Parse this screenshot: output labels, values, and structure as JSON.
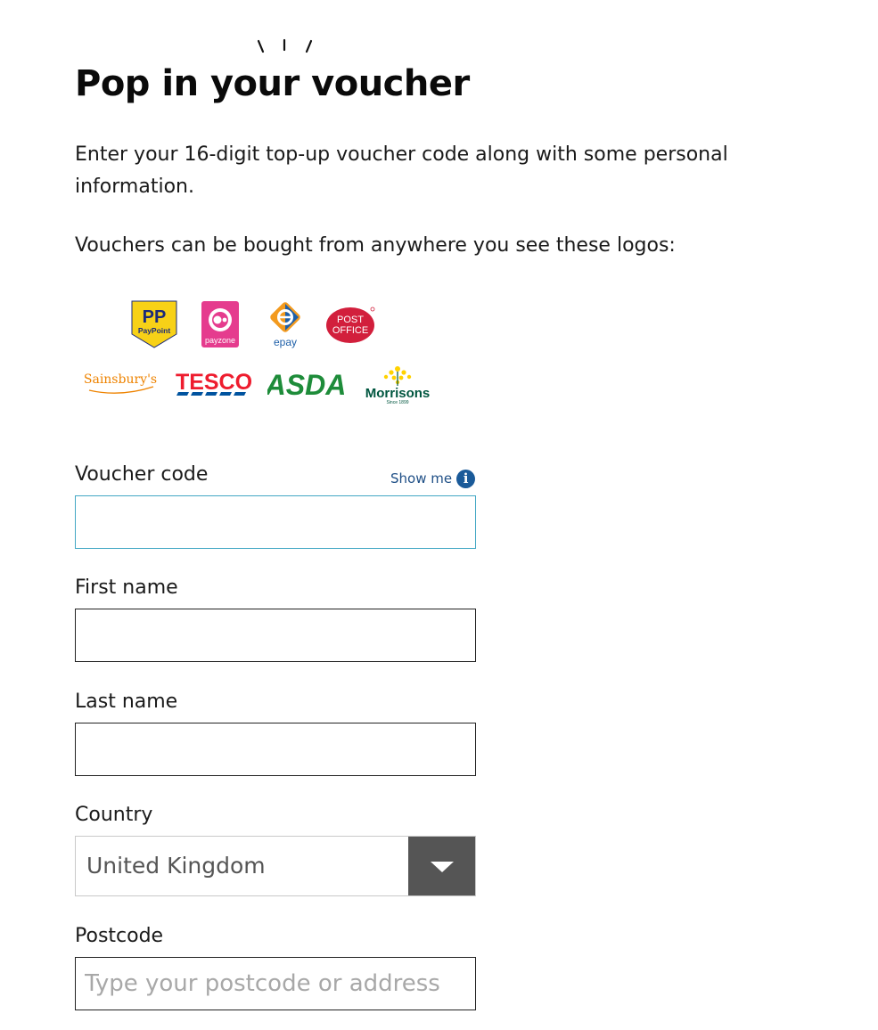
{
  "page": {
    "title": "Pop in your voucher",
    "intro": "Enter your 16-digit top-up voucher code along with some personal information.",
    "vouchers_text": "Vouchers can be bought from anywhere you see these logos:"
  },
  "logos": {
    "paypoint": {
      "monogram": "PP",
      "name": "PayPoint",
      "icon": "paypoint-logo"
    },
    "payzone": {
      "name": "payzone",
      "icon": "payzone-logo"
    },
    "epay": {
      "name": "epay",
      "icon": "epay-logo"
    },
    "post_office": {
      "line1": "POST",
      "line2": "OFFICE",
      "icon": "post-office-logo"
    },
    "sainsburys": {
      "name": "Sainsbury's",
      "icon": "sainsburys-logo"
    },
    "tesco": {
      "name": "TESCO",
      "icon": "tesco-logo"
    },
    "asda": {
      "name": "ASDA",
      "icon": "asda-logo"
    },
    "morrisons": {
      "name": "Morrisons",
      "tagline": "Since 1899",
      "icon": "morrisons-logo"
    }
  },
  "form": {
    "voucher_code": {
      "label": "Voucher code",
      "value": "",
      "placeholder": ""
    },
    "show_me": {
      "label": "Show me",
      "icon": "info-icon",
      "glyph": "i"
    },
    "first_name": {
      "label": "First name",
      "value": "",
      "placeholder": ""
    },
    "last_name": {
      "label": "Last name",
      "value": "",
      "placeholder": ""
    },
    "country": {
      "label": "Country",
      "value": "United Kingdom",
      "icon": "chevron-down-icon"
    },
    "postcode": {
      "label": "Postcode",
      "value": "",
      "placeholder": "Type your postcode or address"
    }
  },
  "colors": {
    "focus_border": "#43a7c4",
    "info_icon": "#1a5a99",
    "show_me_text": "#1f4f86",
    "select_arrow_bg": "#555555",
    "paypoint_yellow": "#f7d117",
    "paypoint_navy": "#1b2a7a",
    "payzone_pink": "#e53c8e",
    "epay_orange": "#f39a1e",
    "epay_blue": "#1e5fa8",
    "post_office_red": "#d21f3c",
    "sainsburys_orange": "#ee8300",
    "tesco_red": "#ee1c2e",
    "tesco_blue": "#00539f",
    "asda_green": "#1e8c3a",
    "morrisons_green": "#00563f",
    "morrisons_yellow": "#ffd200"
  }
}
